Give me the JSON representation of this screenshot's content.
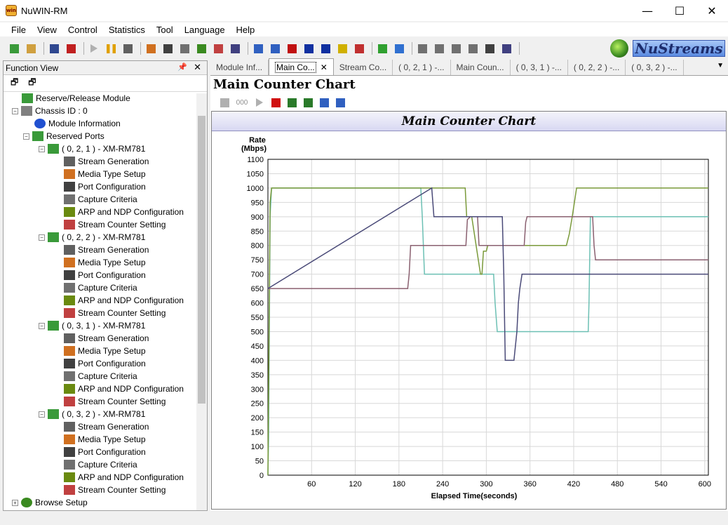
{
  "window": {
    "title": "NuWIN-RM",
    "app_badge": "win"
  },
  "window_buttons": {
    "minimize": "—",
    "maximize": "☐",
    "close": "✕"
  },
  "menu": [
    "File",
    "View",
    "Control",
    "Statistics",
    "Tool",
    "Language",
    "Help"
  ],
  "toolbar_icons": [
    "reserve-icon",
    "open-folder-icon",
    "save-icon",
    "stop-icon",
    "play-icon",
    "pause-icon",
    "report-icon",
    "media-type-icon",
    "port-config-icon",
    "capture-icon",
    "arp-icon",
    "stream-counter-icon",
    "chart-split-icon",
    "grid-icon",
    "line-chart-icon",
    "te-icon",
    "re-icon",
    "table-icon",
    "database-icon",
    "wave-icon",
    "refresh-icon",
    "refresh-blue-icon",
    "doc-icon",
    "doc2-icon",
    "doc3-icon",
    "doc4-icon",
    "key-icon",
    "keyboard-icon"
  ],
  "logo": {
    "text": "NuStreams"
  },
  "function_view": {
    "title": "Function View",
    "pin": "📌",
    "close": "✕",
    "tools": [
      "🗗",
      "🗗"
    ],
    "tree": [
      {
        "label": "Reserve/Release Module",
        "icon": "module-icon",
        "level": 1
      },
      {
        "label": "Chassis ID : 0",
        "icon": "chassis-icon",
        "level": 0,
        "expander": "−"
      },
      {
        "label": "Module Information",
        "icon": "info-icon",
        "level": 2
      },
      {
        "label": "Reserved Ports",
        "icon": "ports-icon",
        "level": 1,
        "expander": "−"
      },
      {
        "label": "( 0, 2, 1 ) - XM-RM781",
        "icon": "port-icon",
        "level": 2,
        "expander": "−"
      },
      {
        "label": "Stream Generation",
        "icon": "stream-gen-icon",
        "level": 3
      },
      {
        "label": "Media Type Setup",
        "icon": "media-type-icon",
        "level": 3
      },
      {
        "label": "Port Configuration",
        "icon": "port-config-icon",
        "level": 3
      },
      {
        "label": "Capture Criteria",
        "icon": "capture-icon",
        "level": 3
      },
      {
        "label": "ARP and NDP Configuration",
        "icon": "arp-icon",
        "level": 3
      },
      {
        "label": "Stream Counter Setting",
        "icon": "stream-counter-icon",
        "level": 3
      },
      {
        "label": "( 0, 2, 2 ) - XM-RM781",
        "icon": "port-icon",
        "level": 2,
        "expander": "−"
      },
      {
        "label": "Stream Generation",
        "icon": "stream-gen-icon",
        "level": 3
      },
      {
        "label": "Media Type Setup",
        "icon": "media-type-icon",
        "level": 3
      },
      {
        "label": "Port Configuration",
        "icon": "port-config-icon",
        "level": 3
      },
      {
        "label": "Capture Criteria",
        "icon": "capture-icon",
        "level": 3
      },
      {
        "label": "ARP and NDP Configuration",
        "icon": "arp-icon",
        "level": 3
      },
      {
        "label": "Stream Counter Setting",
        "icon": "stream-counter-icon",
        "level": 3
      },
      {
        "label": "( 0, 3, 1 ) - XM-RM781",
        "icon": "port-icon",
        "level": 2,
        "expander": "−"
      },
      {
        "label": "Stream Generation",
        "icon": "stream-gen-icon",
        "level": 3
      },
      {
        "label": "Media Type Setup",
        "icon": "media-type-icon",
        "level": 3
      },
      {
        "label": "Port Configuration",
        "icon": "port-config-icon",
        "level": 3
      },
      {
        "label": "Capture Criteria",
        "icon": "capture-icon",
        "level": 3
      },
      {
        "label": "ARP and NDP Configuration",
        "icon": "arp-icon",
        "level": 3
      },
      {
        "label": "Stream Counter Setting",
        "icon": "stream-counter-icon",
        "level": 3
      },
      {
        "label": "( 0, 3, 2 ) - XM-RM781",
        "icon": "port-icon",
        "level": 2,
        "expander": "−"
      },
      {
        "label": "Stream Generation",
        "icon": "stream-gen-icon",
        "level": 3
      },
      {
        "label": "Media Type Setup",
        "icon": "media-type-icon",
        "level": 3
      },
      {
        "label": "Port Configuration",
        "icon": "port-config-icon",
        "level": 3
      },
      {
        "label": "Capture Criteria",
        "icon": "capture-icon",
        "level": 3
      },
      {
        "label": "ARP and NDP Configuration",
        "icon": "arp-icon",
        "level": 3
      },
      {
        "label": "Stream Counter Setting",
        "icon": "stream-counter-icon",
        "level": 3
      },
      {
        "label": "Browse Setup",
        "icon": "globe-icon",
        "level": 0,
        "expander": "+"
      }
    ]
  },
  "tabs": [
    {
      "label": "Module Inf...",
      "active": false
    },
    {
      "label": "Main Co...",
      "active": true,
      "close": "✕"
    },
    {
      "label": "Stream Co...",
      "active": false
    },
    {
      "label": "( 0, 2, 1 ) -...",
      "active": false
    },
    {
      "label": "Main Coun...",
      "active": false
    },
    {
      "label": "( 0, 3, 1 ) -...",
      "active": false
    },
    {
      "label": "( 0, 2, 2 ) -...",
      "active": false
    },
    {
      "label": "( 0, 3, 2 ) -...",
      "active": false
    }
  ],
  "tab_overflow": "▼",
  "content": {
    "title": "Main Counter Chart",
    "tool_icons": [
      "save-icon",
      "counter-icon",
      "play-icon",
      "stop-icon",
      "grid-green-icon",
      "grid-green2-icon",
      "edit-icon",
      "table-icon"
    ],
    "counter_text": "000"
  },
  "chart_data": {
    "type": "line",
    "title": "Main Counter Chart",
    "ylabel_lines": [
      "Rate",
      "(Mbps)"
    ],
    "xlabel": "Elapsed Time(seconds)",
    "xlim": [
      0,
      605
    ],
    "ylim": [
      0,
      1100
    ],
    "xticks": [
      60,
      120,
      180,
      240,
      300,
      360,
      420,
      480,
      540,
      600
    ],
    "yticks": [
      0,
      50,
      100,
      150,
      200,
      250,
      300,
      350,
      400,
      450,
      500,
      550,
      600,
      650,
      700,
      750,
      800,
      850,
      900,
      950,
      1000,
      1050,
      1100
    ],
    "grid": true,
    "series": [
      {
        "color": "#6cc0b4",
        "x": [
          0,
          1,
          3,
          5,
          210,
          212,
          215,
          310,
          312,
          315,
          440,
          441,
          443,
          605
        ],
        "y": [
          0,
          130,
          900,
          1000,
          1000,
          900,
          700,
          700,
          600,
          500,
          500,
          600,
          900,
          900
        ]
      },
      {
        "color": "#7a9a3a",
        "x": [
          0,
          3,
          5,
          271,
          273,
          280,
          292,
          294,
          296,
          300,
          302,
          410,
          414,
          418,
          421,
          424,
          605
        ],
        "y": [
          0,
          950,
          1000,
          1000,
          900,
          900,
          700,
          700,
          780,
          780,
          800,
          800,
          840,
          900,
          950,
          1000,
          1000
        ]
      },
      {
        "color": "#8a6070",
        "x": [
          0,
          1,
          3,
          192,
          194,
          196,
          272,
          274,
          278,
          288,
          290,
          292,
          352,
          354,
          356,
          446,
          448,
          450,
          605
        ],
        "y": [
          650,
          650,
          650,
          650,
          700,
          800,
          800,
          890,
          900,
          900,
          800,
          800,
          800,
          880,
          900,
          900,
          800,
          750,
          750
        ]
      },
      {
        "color": "#4a4a78",
        "x": [
          0,
          225,
          228,
          322,
          324,
          326,
          336,
          338,
          342,
          344,
          346,
          349,
          352,
          605
        ],
        "y": [
          650,
          1000,
          900,
          900,
          700,
          400,
          400,
          400,
          500,
          600,
          650,
          700,
          700,
          700
        ]
      }
    ]
  }
}
